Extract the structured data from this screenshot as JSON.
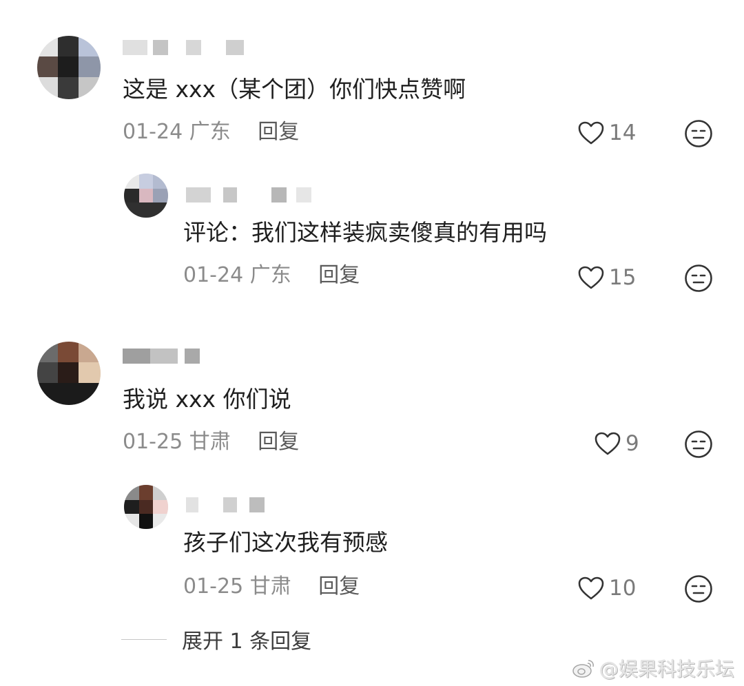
{
  "comments": [
    {
      "text": "这是 xxx（某个团）你们快点赞啊",
      "date": "01-24",
      "location": "广东",
      "reply_label": "回复",
      "likes": "14"
    },
    {
      "text": "评论：我们这样装疯卖傻真的有用吗",
      "date": "01-24",
      "location": "广东",
      "reply_label": "回复",
      "likes": "15"
    },
    {
      "text": "我说 xxx 你们说",
      "date": "01-25",
      "location": "甘肃",
      "reply_label": "回复",
      "likes": "9"
    },
    {
      "text": "孩子们这次我有预感",
      "date": "01-25",
      "location": "甘肃",
      "reply_label": "回复",
      "likes": "10"
    }
  ],
  "expand_label": "展开 1 条回复",
  "watermark": "@娱果科技乐坛",
  "icons": {
    "like": "heart-outline-icon",
    "dislike": "meh-face-icon",
    "watermark": "weibo-logo-icon"
  }
}
